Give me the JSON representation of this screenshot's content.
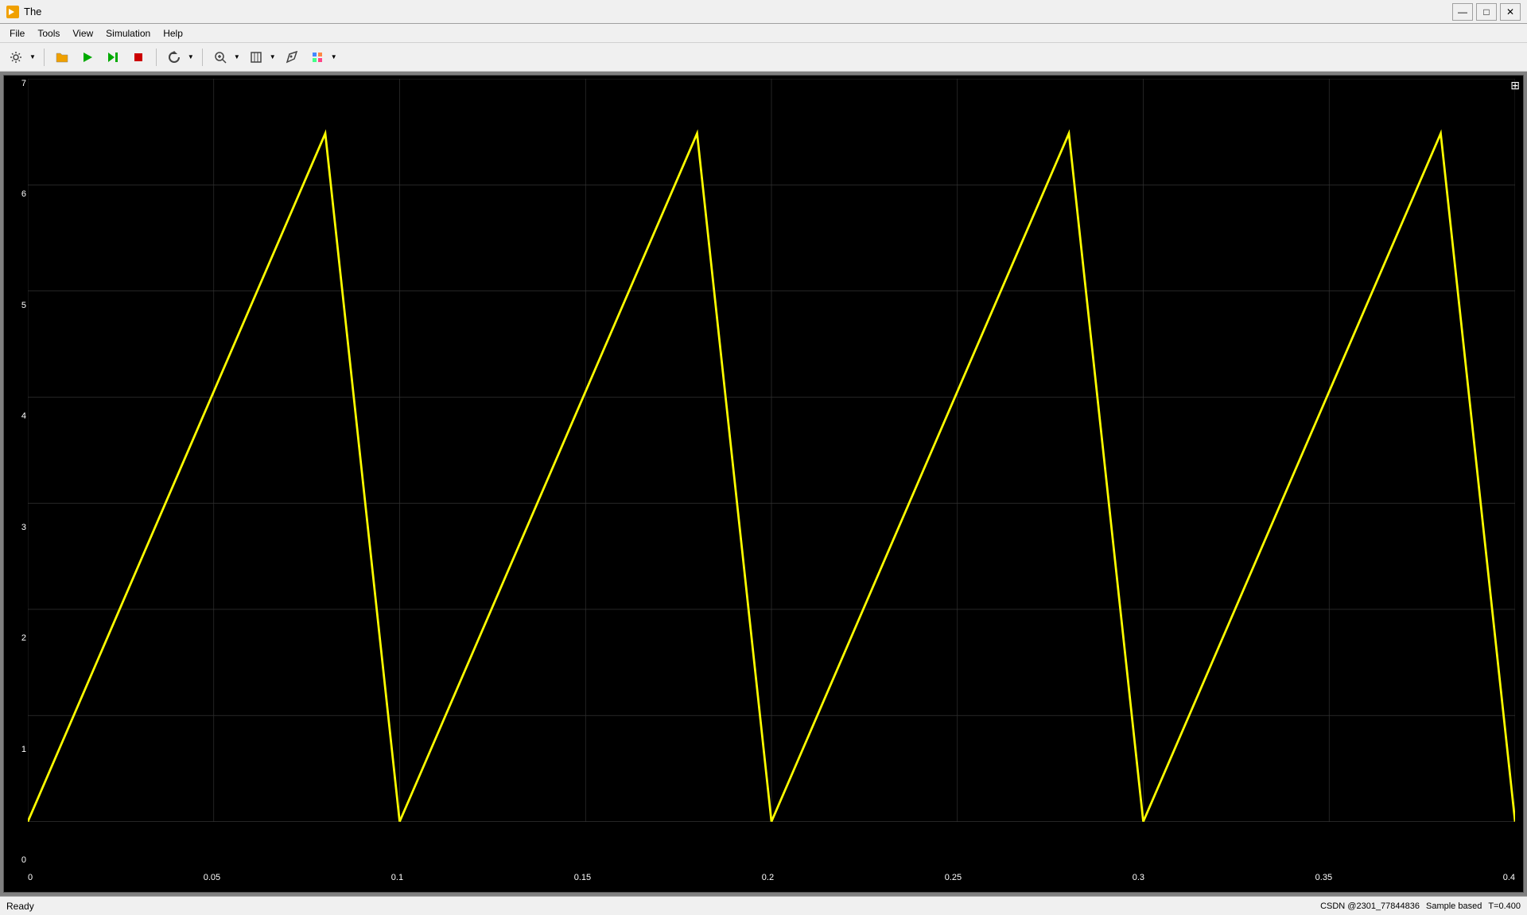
{
  "titleBar": {
    "title": "The",
    "icon": "simulink-icon"
  },
  "menuBar": {
    "items": [
      "File",
      "Tools",
      "View",
      "Simulation",
      "Help"
    ]
  },
  "toolbar": {
    "buttons": [
      {
        "name": "settings-btn",
        "icon": "⚙",
        "label": "Settings"
      },
      {
        "name": "open-btn",
        "icon": "📂",
        "label": "Open"
      },
      {
        "name": "run-btn",
        "icon": "▶",
        "label": "Run"
      },
      {
        "name": "step-btn",
        "icon": "⏩",
        "label": "Step"
      },
      {
        "name": "stop-btn",
        "icon": "⏹",
        "label": "Stop"
      },
      {
        "name": "zoom-btn",
        "icon": "🔍",
        "label": "Zoom"
      },
      {
        "name": "fit-btn",
        "icon": "⊡",
        "label": "Fit"
      },
      {
        "name": "draw-btn",
        "icon": "✏",
        "label": "Draw"
      },
      {
        "name": "style-btn",
        "icon": "🖌",
        "label": "Style"
      }
    ]
  },
  "plot": {
    "backgroundColor": "#000000",
    "lineColor": "#ffff00",
    "gridColor": "#333333",
    "yAxis": {
      "min": 0,
      "max": 7,
      "labels": [
        "7",
        "6",
        "5",
        "4",
        "3",
        "2",
        "1",
        "0"
      ]
    },
    "xAxis": {
      "min": 0,
      "max": 0.4,
      "labels": [
        "0",
        "0.05",
        "0.1",
        "0.15",
        "0.2",
        "0.25",
        "0.3",
        "0.35",
        "0.4"
      ]
    },
    "sawtoothWaves": [
      {
        "x1": 0,
        "y1": 0,
        "x2": 0.1,
        "y2": 6.5,
        "x3": 0.1,
        "y3": 0
      },
      {
        "x1": 0.1,
        "y1": 0,
        "x2": 0.2,
        "y2": 6.5,
        "x3": 0.2,
        "y3": 0
      },
      {
        "x1": 0.2,
        "y1": 0,
        "x2": 0.3,
        "y2": 6.5,
        "x3": 0.3,
        "y3": 0
      },
      {
        "x1": 0.3,
        "y1": 0,
        "x2": 0.4,
        "y2": 6.5,
        "x3": 0.4,
        "y3": 0
      }
    ]
  },
  "statusBar": {
    "status": "Ready",
    "sampleInfo": "Sample based",
    "timeInfo": "T=0.400",
    "attribution": "CSDN @2301_77844836"
  },
  "expandIcon": "⊞"
}
